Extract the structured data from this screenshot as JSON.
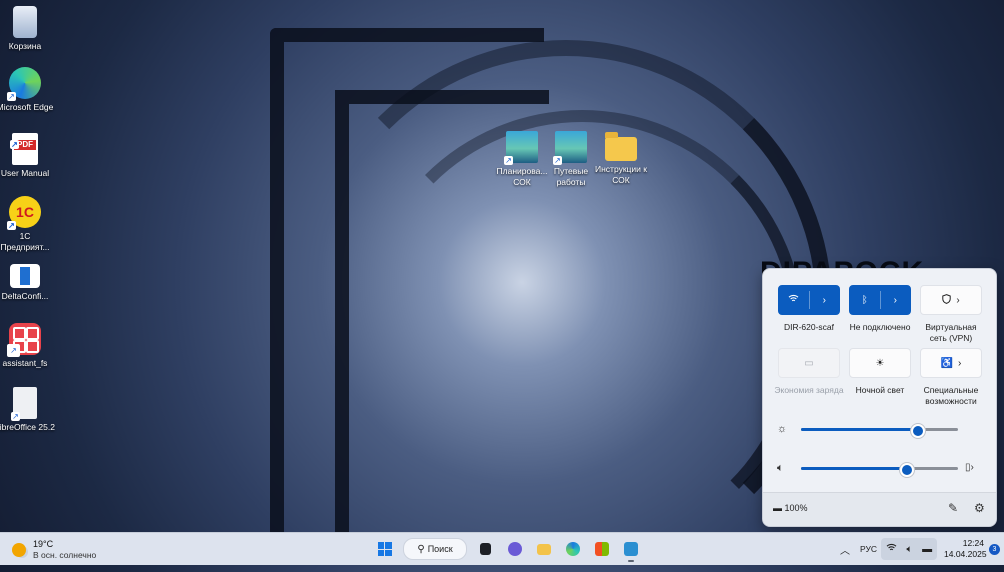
{
  "wallpaper": {
    "brand_text": "DIPAPOCK"
  },
  "desktop": {
    "left_icons": [
      {
        "label": "Корзина",
        "icon": "recycle-bin-icon"
      },
      {
        "label": "Microsoft Edge",
        "icon": "edge-icon"
      },
      {
        "label": "User Manual",
        "icon": "pdf-icon",
        "badge": "PDF"
      },
      {
        "label": "1С Предприят...",
        "icon": "1c-icon",
        "badge": "1C"
      },
      {
        "label": "DeltaConfi...",
        "icon": "delta-config-icon"
      },
      {
        "label": "assistant_fs",
        "icon": "assistant-icon"
      },
      {
        "label": "LibreOffice 25.2",
        "icon": "libreoffice-icon"
      }
    ],
    "mid_icons": [
      {
        "label": "Планирова... СОК",
        "icon": "planning-app-icon"
      },
      {
        "label": "Путевые работы",
        "icon": "route-works-app-icon"
      },
      {
        "label": "Инструкции к СОК",
        "icon": "folder-icon"
      }
    ]
  },
  "quick_settings": {
    "tiles": [
      {
        "label": "DIR-620-scaf",
        "state": "on",
        "icon": "wifi-icon"
      },
      {
        "label": "Не подключено",
        "state": "on",
        "icon": "bluetooth-icon"
      },
      {
        "label": "Виртуальная сеть (VPN)",
        "state": "off",
        "icon": "vpn-shield-icon"
      },
      {
        "label": "Экономия заряда",
        "state": "disabled",
        "icon": "battery-saver-icon"
      },
      {
        "label": "Ночной свет",
        "state": "off",
        "icon": "night-light-icon"
      },
      {
        "label": "Специальные возможности",
        "state": "off",
        "icon": "accessibility-icon"
      }
    ],
    "brightness": 0.73,
    "volume": 0.66,
    "battery_text": "100%"
  },
  "taskbar": {
    "weather": {
      "temp": "19°C",
      "desc": "В осн. солнечно"
    },
    "search_label": "Поиск",
    "tray": {
      "lang": "РУС",
      "time": "12:24",
      "date": "14.04.2025",
      "notifications": "3"
    }
  },
  "colors": {
    "accent": "#0b5cbf",
    "taskbar": "#dde3ee"
  }
}
